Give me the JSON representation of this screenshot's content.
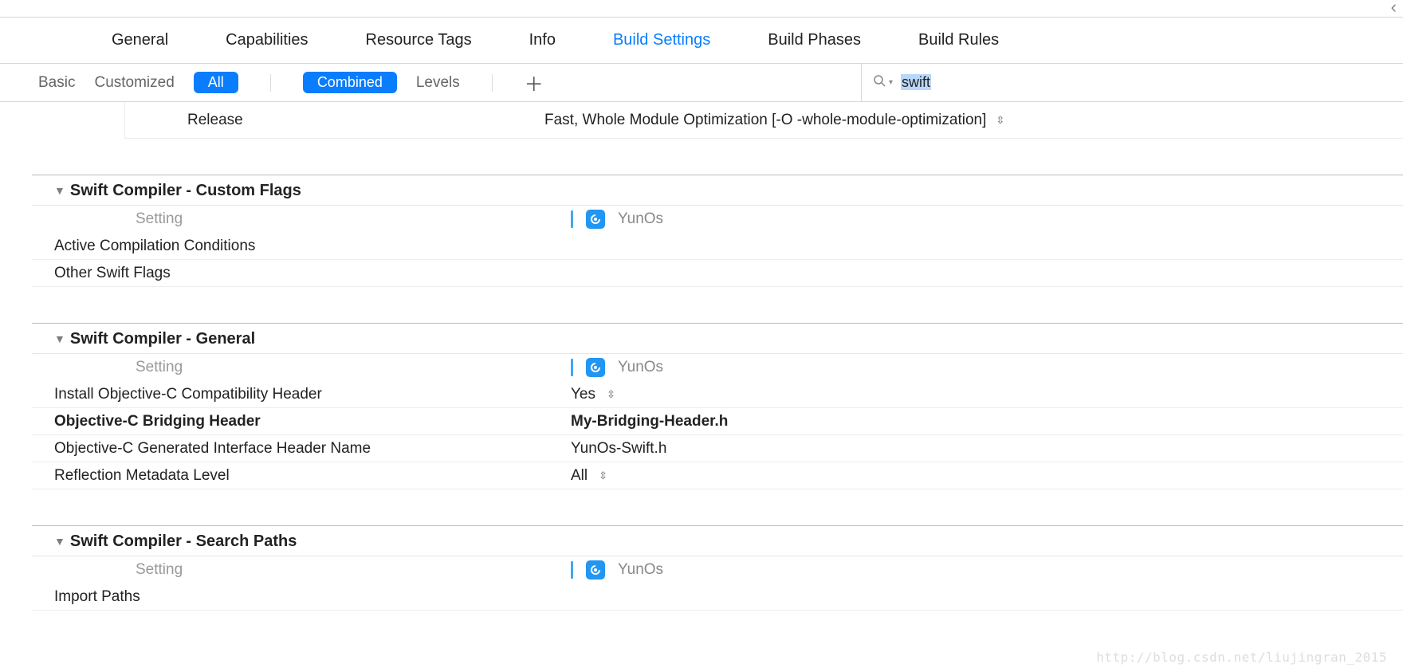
{
  "header": {
    "tabs": [
      "General",
      "Capabilities",
      "Resource Tags",
      "Info",
      "Build Settings",
      "Build Phases",
      "Build Rules"
    ],
    "active_tab": "Build Settings"
  },
  "filters": {
    "basic": "Basic",
    "customized": "Customized",
    "all": "All",
    "combined": "Combined",
    "levels": "Levels"
  },
  "search": {
    "query": "swift"
  },
  "top_row": {
    "label": "Release",
    "value": "Fast, Whole Module Optimization  [-O -whole-module-optimization]"
  },
  "setting_column_header": "Setting",
  "target_name": "YunOs",
  "sections": [
    {
      "title": "Swift Compiler - Custom Flags",
      "rows": [
        {
          "label": "Active Compilation Conditions",
          "value": ""
        },
        {
          "label": "Other Swift Flags",
          "value": ""
        }
      ]
    },
    {
      "title": "Swift Compiler - General",
      "rows": [
        {
          "label": "Install Objective-C Compatibility Header",
          "value": "Yes",
          "chooser": true
        },
        {
          "label": "Objective-C Bridging Header",
          "value": "My-Bridging-Header.h",
          "bold": true
        },
        {
          "label": "Objective-C Generated Interface Header Name",
          "value": "YunOs-Swift.h"
        },
        {
          "label": "Reflection Metadata Level",
          "value": "All",
          "chooser": true
        }
      ]
    },
    {
      "title": "Swift Compiler - Search Paths",
      "rows": [
        {
          "label": "Import Paths",
          "value": ""
        }
      ]
    }
  ],
  "watermark": "http://blog.csdn.net/liujingran_2015"
}
